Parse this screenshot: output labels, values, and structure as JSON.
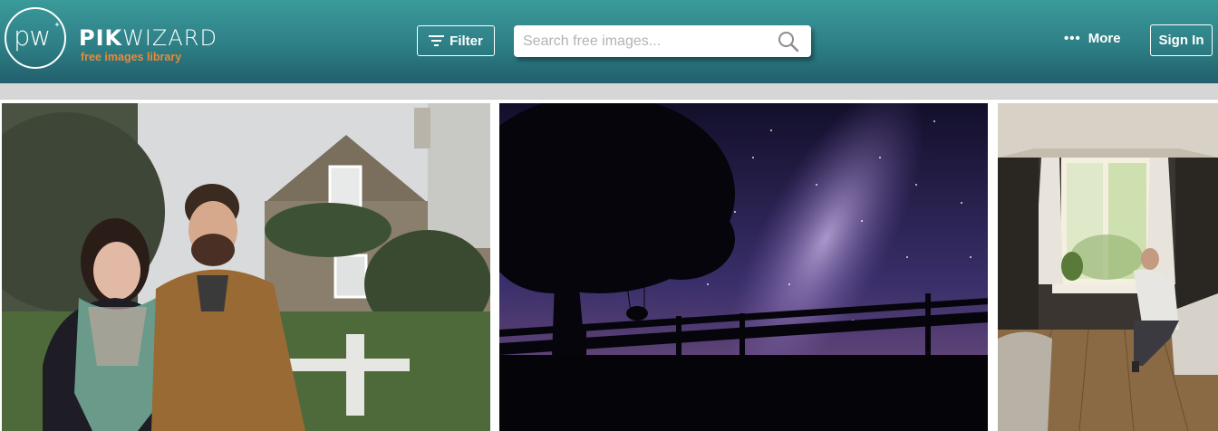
{
  "brand": {
    "logo_text": "pw",
    "name_bold": "PIK",
    "name_light": "WIZARD",
    "tagline": "free images library"
  },
  "header": {
    "filter_label": "Filter",
    "more_label": "More",
    "signin_label": "Sign In"
  },
  "search": {
    "placeholder": "Search free images...",
    "value": ""
  },
  "icons": {
    "filter": "filter-icon",
    "search": "search-icon",
    "more": "dots-icon"
  },
  "colors": {
    "header_top": "#3b9a9a",
    "header_bottom": "#225f6c",
    "tagline": "#e88a3a"
  },
  "gallery": [
    {
      "subject": "couple-in-front-of-cottage"
    },
    {
      "subject": "milky-way-night-sky-with-swing"
    },
    {
      "subject": "man-sitting-on-bed-by-window"
    }
  ]
}
